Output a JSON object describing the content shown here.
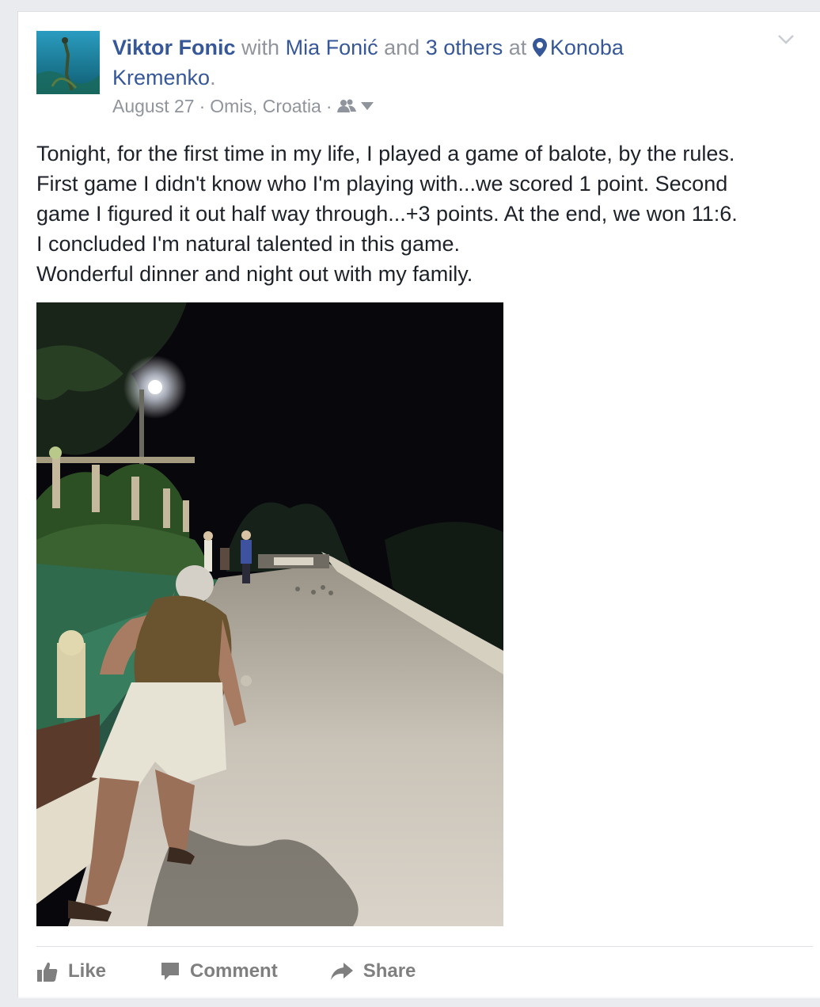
{
  "post": {
    "author": "Viktor Fonic",
    "with_word": "with",
    "tagged_friend": "Mia Fonić",
    "and_word": "and",
    "others": "3 others",
    "at_word": "at",
    "place_line1": "Konoba",
    "place_line2": "Kremenko",
    "period": ".",
    "date": "August 27",
    "separator": "·",
    "location": "Omis, Croatia",
    "audience_icon": "friends-audience-icon",
    "text_lines": [
      "Tonight, for the first time in my life, I played a game of balote, by the rules.",
      "First game I didn't know who I'm playing with...we scored 1 point. Second",
      "game I figured it out half way through...+3 points. At the end, we won 11:6.",
      "I concluded I'm natural talented in this game.",
      "Wonderful dinner and night out with my family."
    ]
  },
  "actions": {
    "like": "Like",
    "comment": "Comment",
    "share": "Share"
  },
  "colors": {
    "link": "#365899",
    "muted": "#90949c",
    "text": "#1d2129",
    "action": "#7f7f7f",
    "background": "#e9ebee"
  }
}
